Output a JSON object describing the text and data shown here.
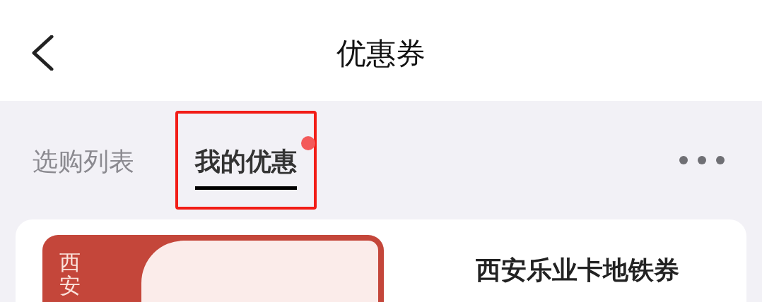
{
  "header": {
    "title": "优惠券"
  },
  "tabs": [
    {
      "label": "选购列表",
      "selected": false,
      "badge": false,
      "highlighted": false
    },
    {
      "label": "我的优惠",
      "selected": true,
      "badge": true,
      "highlighted": true
    }
  ],
  "coupon": {
    "side_text": "西安",
    "name": "西安乐业卡地铁券"
  }
}
